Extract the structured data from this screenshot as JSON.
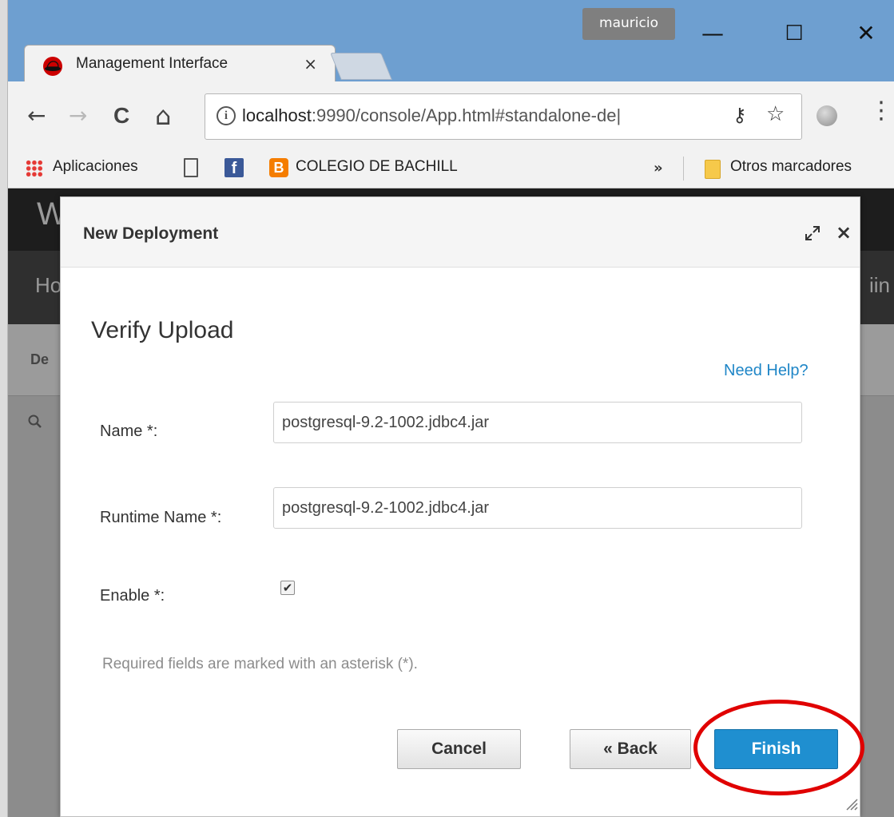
{
  "window": {
    "user_label": "mauricio",
    "minimize": "—",
    "maximize": "☐",
    "close": "✕"
  },
  "tab": {
    "title": "Management Interface",
    "close": "×"
  },
  "toolbar": {
    "back": "←",
    "forward": "→",
    "reload": "C",
    "home": "⌂",
    "info": "i",
    "url_host": "localhost",
    "url_rest": ":9990/console/App.html#standalone-de|",
    "key_icon": "⚷",
    "star_icon": "☆",
    "menu": "⋮"
  },
  "bookmarks": {
    "apps": "Aplicaciones",
    "facebook_letter": "f",
    "blogger_letter": "B",
    "colegio": "COLEGIO DE BACHILL",
    "overflow": "»",
    "other": "Otros marcadores"
  },
  "background_app": {
    "header_letter": "W",
    "nav_left": "Ho",
    "nav_right": "iin",
    "sub_label": "De",
    "search_icon": "magnifier"
  },
  "modal": {
    "title": "New Deployment",
    "close": "×",
    "step_title": "Verify Upload",
    "help_link": "Need Help?",
    "fields": {
      "name_label": "Name *:",
      "name_value": "postgresql-9.2-1002.jdbc4.jar",
      "runtime_label": "Runtime Name *:",
      "runtime_value": "postgresql-9.2-1002.jdbc4.jar",
      "enable_label": "Enable *:",
      "enable_checked": true,
      "check_glyph": "✔"
    },
    "required_note": "Required fields are marked with an asterisk (*).",
    "buttons": {
      "cancel": "Cancel",
      "back": "« Back",
      "finish": "Finish"
    }
  },
  "colors": {
    "accent_blue": "#1f8fd0",
    "link_blue": "#1f86c7",
    "annotation_red": "#e00000",
    "titlebar": "#6e9fd0"
  }
}
